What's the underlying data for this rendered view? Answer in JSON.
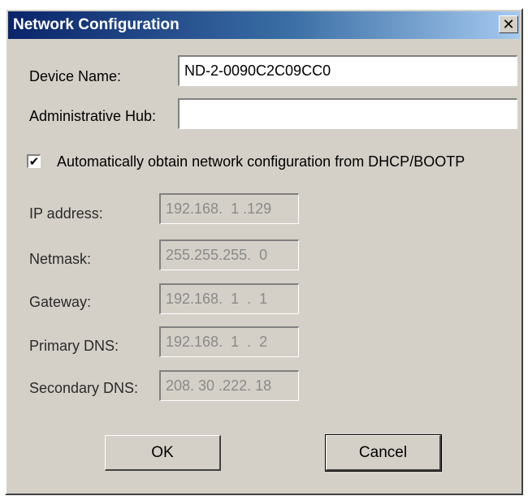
{
  "window": {
    "title": "Network Configuration",
    "close_glyph": "✕"
  },
  "form": {
    "device_name_label": "Device Name:",
    "device_name_value": "ND-2-0090C2C09CC0",
    "admin_hub_label": "Administrative Hub:",
    "admin_hub_value": "",
    "dhcp_checked": true,
    "dhcp_check_glyph": "✔",
    "dhcp_label": "Automatically obtain network configuration from DHCP/BOOTP"
  },
  "network_fields": [
    {
      "label": "IP address:",
      "value": "192.168.  1 .129"
    },
    {
      "label": "Netmask:",
      "value": "255.255.255.  0"
    },
    {
      "label": "Gateway:",
      "value": "192.168.  1  .  1"
    },
    {
      "label": "Primary DNS:",
      "value": "192.168.  1  .  2"
    },
    {
      "label": "Secondary DNS:",
      "value": "208. 30 .222. 18"
    }
  ],
  "buttons": {
    "ok_label": "OK",
    "cancel_label": "Cancel"
  },
  "icons": {
    "close": "close-icon",
    "check": "checkmark-icon"
  }
}
